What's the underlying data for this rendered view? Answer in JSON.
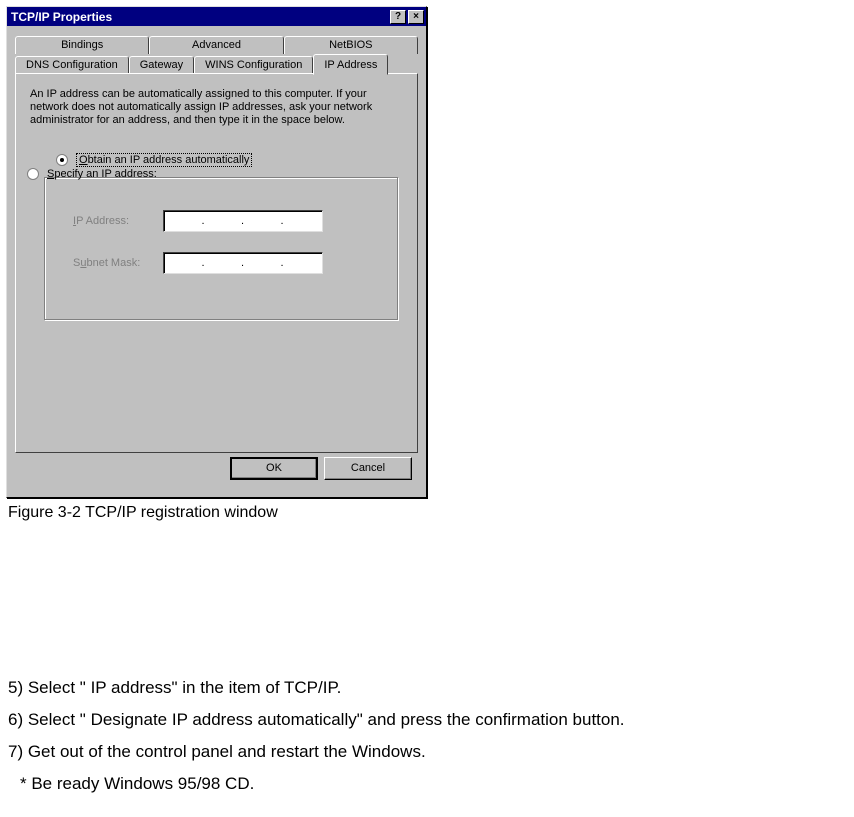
{
  "dialog": {
    "title": "TCP/IP Properties",
    "help_btn": "?",
    "close_btn": "×",
    "tabs_back": [
      "Bindings",
      "Advanced",
      "NetBIOS"
    ],
    "tabs_front": [
      "DNS Configuration",
      "Gateway",
      "WINS Configuration",
      "IP Address"
    ],
    "active_tab": "IP Address",
    "description": "An IP address can be automatically assigned to this computer. If your network does not automatically assign IP addresses, ask your network administrator for an address, and then type it in the space below.",
    "radio_auto_prefix": "O",
    "radio_auto_rest": "btain an IP address automatically",
    "radio_specify_prefix": "S",
    "radio_specify_rest": "pecify an IP address:",
    "ip_label_prefix": "I",
    "ip_label_rest": "P Address:",
    "subnet_label_prefix": "u",
    "subnet_label_pre": "S",
    "subnet_label_rest": "bnet Mask:",
    "ok_label": "OK",
    "cancel_label": "Cancel"
  },
  "caption": "Figure 3-2 TCP/IP registration window",
  "steps": {
    "s5": "5) Select \" IP address\"  in the item of TCP/IP.",
    "s6": "6) Select \" Designate IP address automatically\"  and press the confirmation  button.",
    "s7": "7) Get out of the control panel and restart the Windows.",
    "note": "* Be ready Windows 95/98 CD."
  }
}
